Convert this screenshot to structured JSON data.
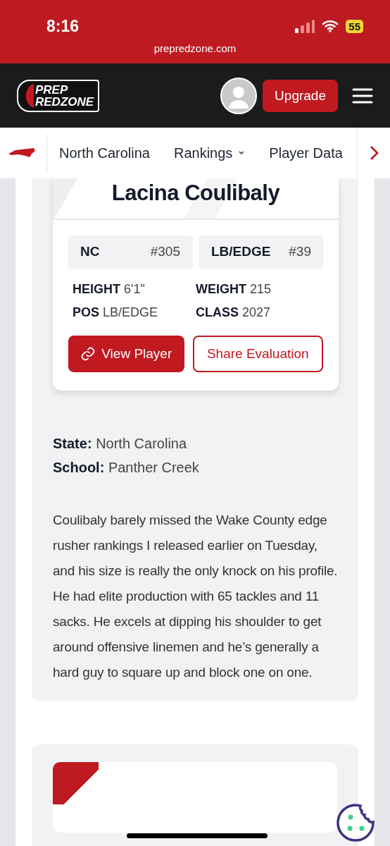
{
  "status_bar": {
    "time": "8:16",
    "battery": "55",
    "url": "prepredzone.com"
  },
  "header": {
    "logo_lines": [
      "PREP",
      "REDZONE"
    ],
    "upgrade": "Upgrade"
  },
  "nav": {
    "items": [
      {
        "label": "North Carolina",
        "dropdown": false
      },
      {
        "label": "Rankings",
        "dropdown": true
      },
      {
        "label": "Player Data",
        "dropdown": false
      }
    ]
  },
  "player_card": {
    "name": "Lacina Coulibaly",
    "ranks": [
      {
        "label": "NC",
        "rank": "#305"
      },
      {
        "label": "LB/EDGE",
        "rank": "#39"
      }
    ],
    "stats": [
      {
        "label": "HEIGHT",
        "value": "6'1\""
      },
      {
        "label": "WEIGHT",
        "value": "215"
      },
      {
        "label": "POS",
        "value": "LB/EDGE"
      },
      {
        "label": "CLASS",
        "value": "2027"
      }
    ],
    "buttons": [
      {
        "label": "View Player",
        "kind": "primary"
      },
      {
        "label": "Share Evaluation",
        "kind": "outline"
      }
    ]
  },
  "details": [
    {
      "label": "State:",
      "value": "North Carolina"
    },
    {
      "label": "School:",
      "value": "Panther Creek"
    }
  ],
  "evaluation": "Coulibaly barely missed the Wake County edge rusher rankings I released earlier on Tuesday, and his size is really the only knock on his profile. He had elite production with 65 tackles and 11 sacks. He excels at dipping his shoulder to get around offensive linemen and he’s generally a hard guy to square up and block one on one."
}
